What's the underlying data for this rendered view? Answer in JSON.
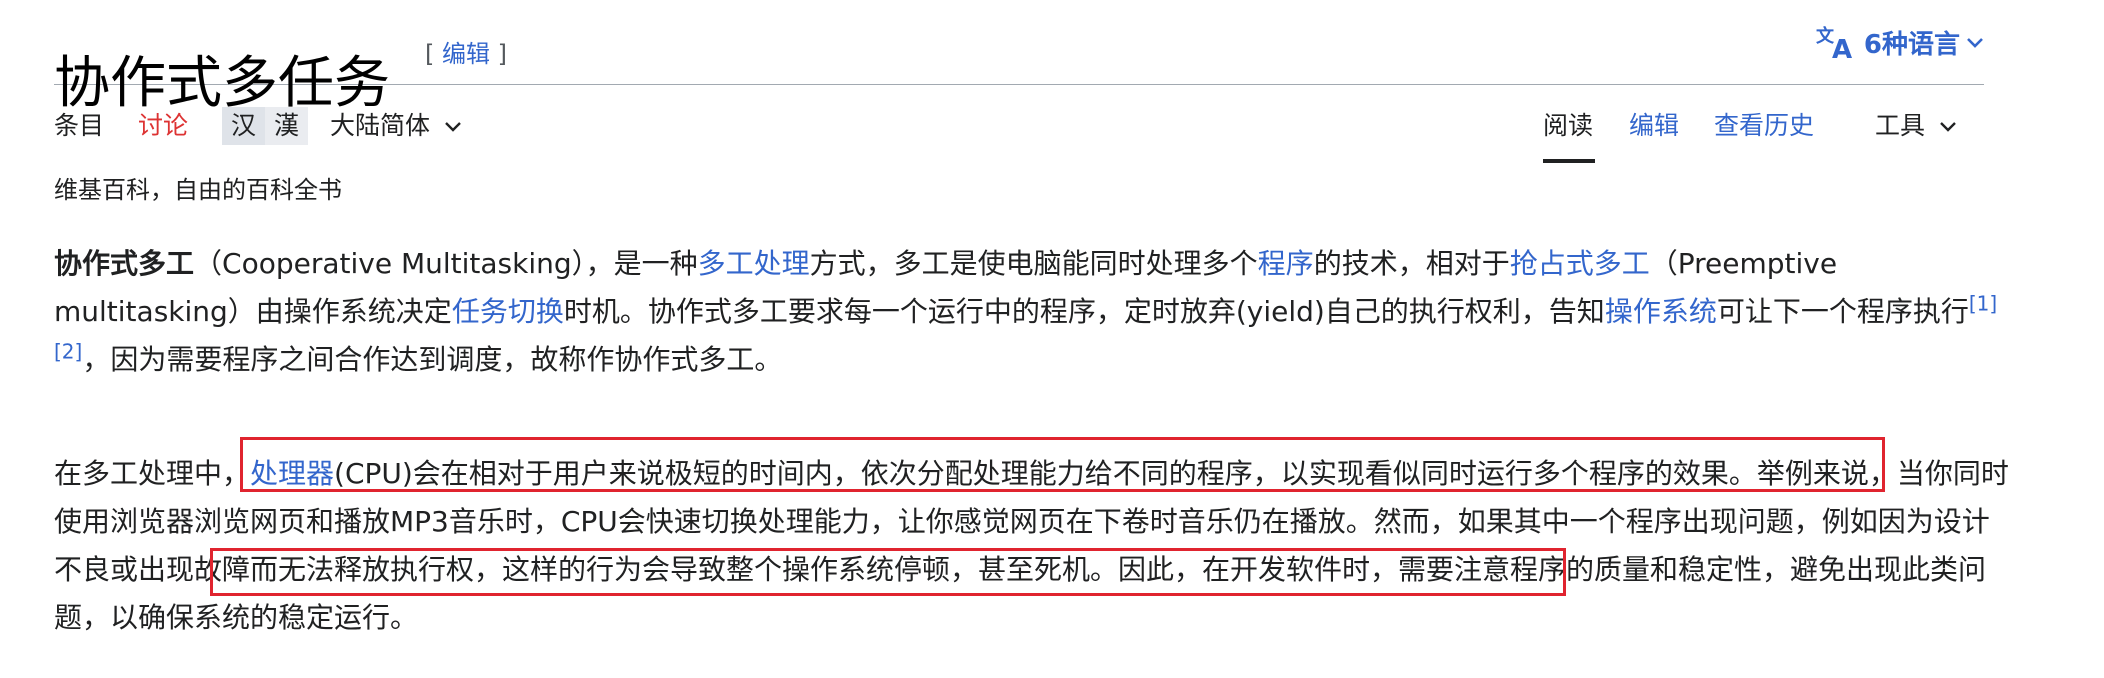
{
  "header": {
    "title": "协作式多任务",
    "edit_open": "[ ",
    "edit_label": "编辑",
    "edit_close": " ]",
    "languages_label": "6种语言",
    "languages_icon": "translate-icon"
  },
  "tabs": {
    "left": [
      "条目",
      "讨论"
    ],
    "script_variant": [
      "汉",
      "漢"
    ],
    "variant_menu": "大陆简体",
    "right": [
      "阅读",
      "编辑",
      "查看历史",
      "工具"
    ]
  },
  "tagline": "维基百科，自由的百科全书",
  "para1": {
    "bold_term": "协作式多工",
    "t1": "（Cooperative Multitasking），是一种",
    "link1": "多工处理",
    "t2": "方式，多工是使电脑能同时处理多个",
    "link2": "程序",
    "t3": "的技术，相对于",
    "link3": "抢占式多工",
    "t4": "（Preemptive multitasking）由操作系统决定",
    "link4": "任务切换",
    "t5": "时机。协作式多工要求每一个运行中的程序，定时放弃(yield)自己的执行权利，告知",
    "link5": "操作系统",
    "t6": "可让下一个程序执行",
    "ref1": "[1]",
    "ref2": "[2]",
    "t7": "，因为需要程序之间合作达到调度，故称作协作式多工。"
  },
  "para2": {
    "t1": "在多工处理中，",
    "link1": "处理器",
    "t2": "(CPU)会在相对于用户来说极短的时间内，依次分配处理能力给不同的程序，以实现看似同时运行多个程序的效果。",
    "t3": "举例来说，当你同时使用浏览器浏览网页和播放MP3音乐时，CPU会快速切换处理能力，让你感觉网页在下卷时音乐仍在播放。然而，如果其中一个程序出现问题，",
    "t4": "例如因为设计不良或出现故障而无法释放执行权，这样的行为会导致整个操作系统停顿，甚至死机。",
    "t5": "因此，在开发软件时，需要注意程序的质量和稳定性，避免出现此类问题，以确保系统的稳定运行。"
  },
  "colors": {
    "link": "#3366cc",
    "talk_red": "#d33",
    "highlight_box": "#e0242f"
  }
}
